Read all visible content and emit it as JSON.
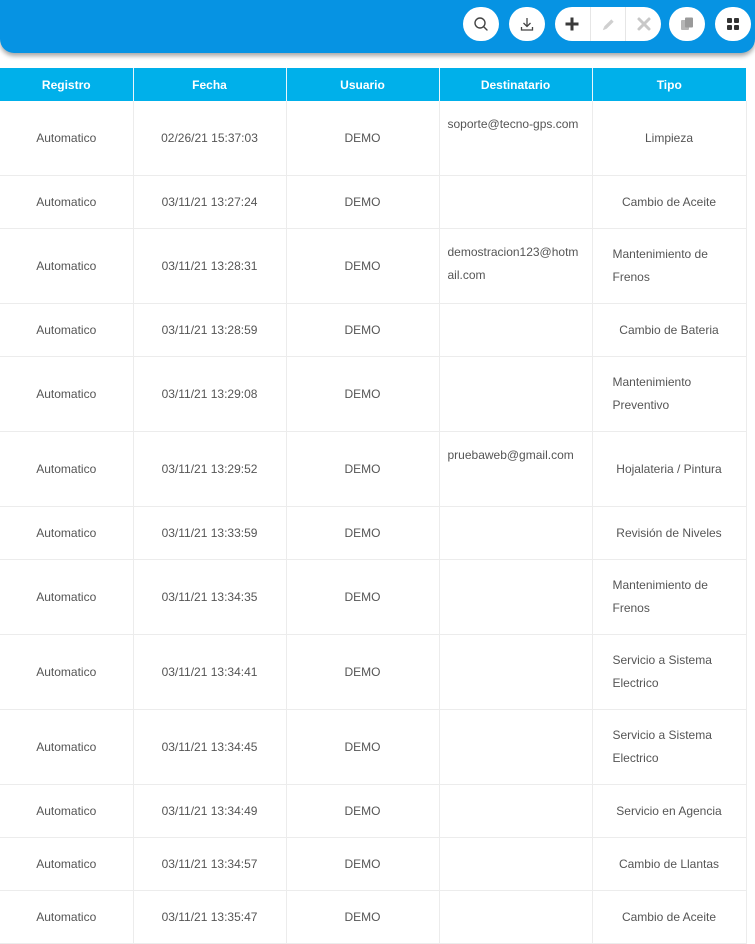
{
  "toolbar": {
    "buttons": [
      {
        "name": "search",
        "icon": "search-icon"
      },
      {
        "name": "download",
        "icon": "download-icon"
      },
      {
        "name": "add",
        "icon": "plus-icon"
      },
      {
        "name": "edit",
        "icon": "pencil-icon"
      },
      {
        "name": "delete",
        "icon": "close-icon"
      },
      {
        "name": "copy",
        "icon": "copy-icon"
      },
      {
        "name": "grid",
        "icon": "grid-icon"
      }
    ],
    "colors": {
      "bar": "#0693e3",
      "header": "#00b0ea"
    }
  },
  "table": {
    "headers": [
      "Registro",
      "Fecha",
      "Usuario",
      "Destinatario",
      "Tipo"
    ],
    "rows": [
      {
        "registro": "Automatico",
        "fecha": "02/26/21 15:37:03",
        "usuario": "DEMO",
        "destinatario": "soporte@tecno-gps.com",
        "tipo": "Limpieza"
      },
      {
        "registro": "Automatico",
        "fecha": "03/11/21 13:27:24",
        "usuario": "DEMO",
        "destinatario": "",
        "tipo": "Cambio de Aceite"
      },
      {
        "registro": "Automatico",
        "fecha": "03/11/21 13:28:31",
        "usuario": "DEMO",
        "destinatario": "demostracion123@hotmail.com",
        "tipo": "Mantenimiento de Frenos"
      },
      {
        "registro": "Automatico",
        "fecha": "03/11/21 13:28:59",
        "usuario": "DEMO",
        "destinatario": "",
        "tipo": "Cambio de Bateria"
      },
      {
        "registro": "Automatico",
        "fecha": "03/11/21 13:29:08",
        "usuario": "DEMO",
        "destinatario": "",
        "tipo": "Mantenimiento Preventivo"
      },
      {
        "registro": "Automatico",
        "fecha": "03/11/21 13:29:52",
        "usuario": "DEMO",
        "destinatario": "pruebaweb@gmail.com",
        "tipo": "Hojalateria / Pintura"
      },
      {
        "registro": "Automatico",
        "fecha": "03/11/21 13:33:59",
        "usuario": "DEMO",
        "destinatario": "",
        "tipo": "Revisión de Niveles"
      },
      {
        "registro": "Automatico",
        "fecha": "03/11/21 13:34:35",
        "usuario": "DEMO",
        "destinatario": "",
        "tipo": "Mantenimiento de Frenos"
      },
      {
        "registro": "Automatico",
        "fecha": "03/11/21 13:34:41",
        "usuario": "DEMO",
        "destinatario": "",
        "tipo": "Servicio a Sistema Electrico"
      },
      {
        "registro": "Automatico",
        "fecha": "03/11/21 13:34:45",
        "usuario": "DEMO",
        "destinatario": "",
        "tipo": "Servicio a Sistema Electrico"
      },
      {
        "registro": "Automatico",
        "fecha": "03/11/21 13:34:49",
        "usuario": "DEMO",
        "destinatario": "",
        "tipo": "Servicio en Agencia"
      },
      {
        "registro": "Automatico",
        "fecha": "03/11/21 13:34:57",
        "usuario": "DEMO",
        "destinatario": "",
        "tipo": "Cambio de Llantas"
      },
      {
        "registro": "Automatico",
        "fecha": "03/11/21 13:35:47",
        "usuario": "DEMO",
        "destinatario": "",
        "tipo": "Cambio de Aceite"
      }
    ]
  }
}
